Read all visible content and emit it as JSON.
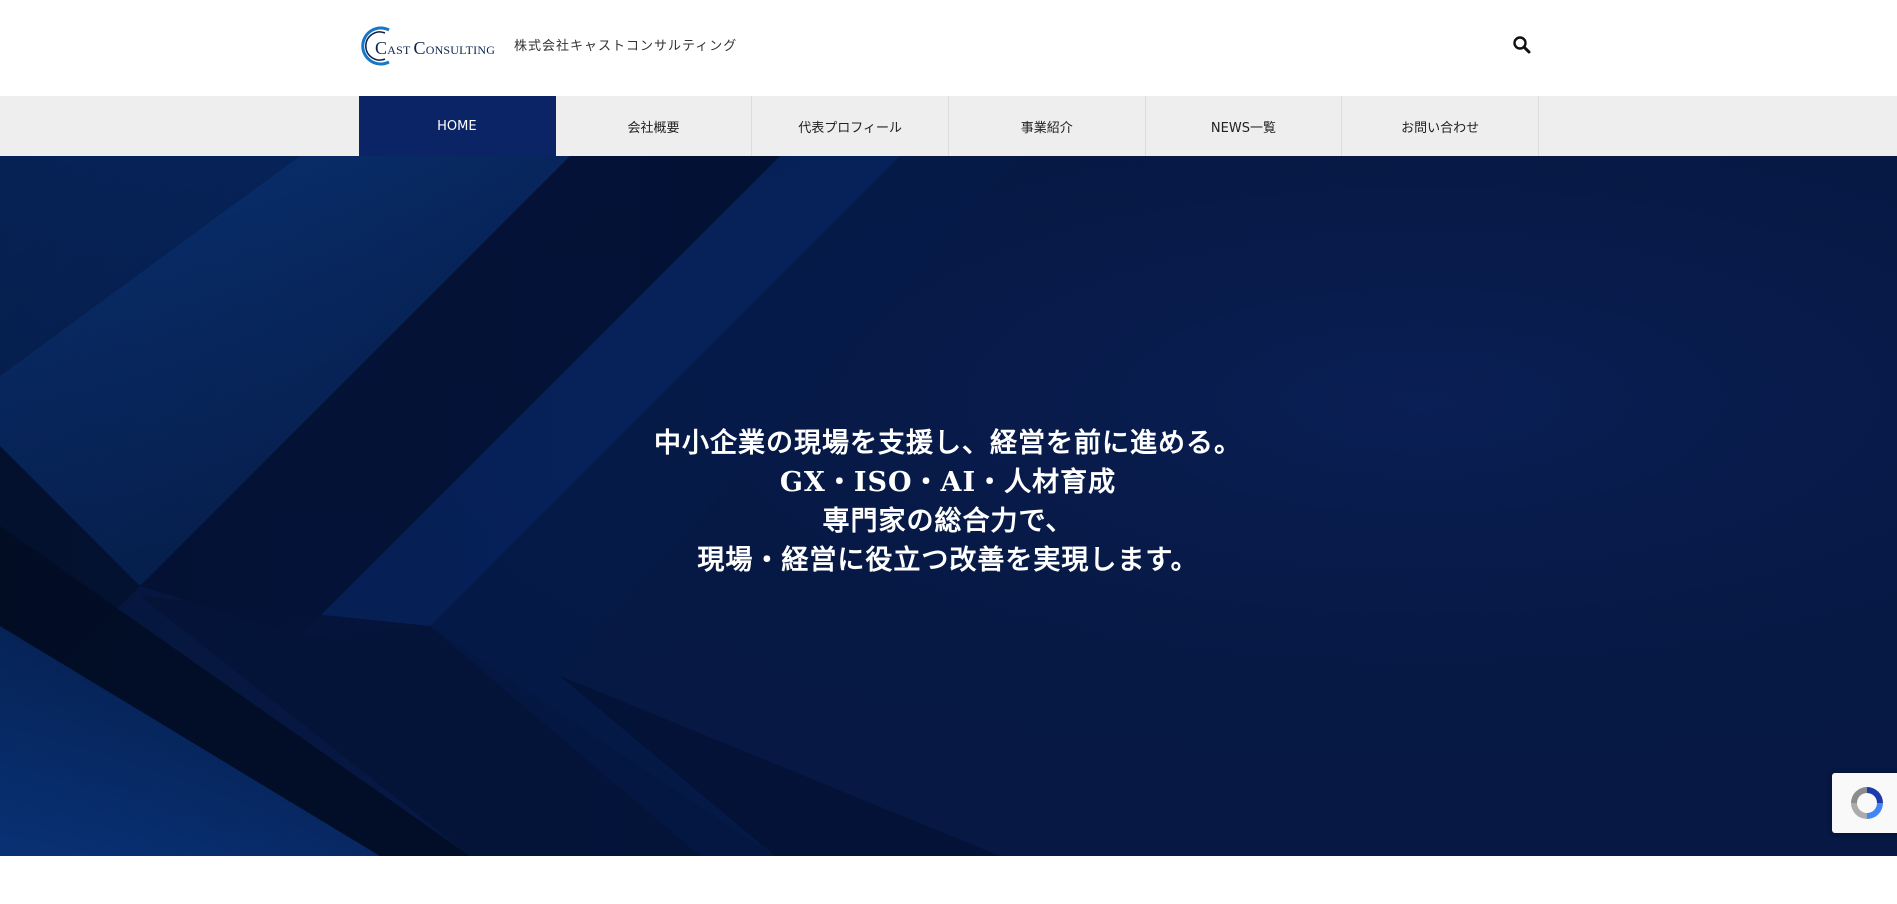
{
  "header": {
    "logo": {
      "text_first": "C",
      "text_rest": "AST ",
      "text_second": "C",
      "text_second_rest": "ONSULTING",
      "alt": "Cast Consulting"
    },
    "company_name": "株式会社キャストコンサルティング",
    "search_icon": "search-icon"
  },
  "nav": {
    "items": [
      {
        "label": "HOME",
        "active": true
      },
      {
        "label": "会社概要",
        "active": false
      },
      {
        "label": "代表プロフィール",
        "active": false
      },
      {
        "label": "事業紹介",
        "active": false
      },
      {
        "label": "NEWS一覧",
        "active": false
      },
      {
        "label": "お問い合わせ",
        "active": false
      }
    ]
  },
  "hero": {
    "lines": [
      "中小企業の現場を支援し、経営を前に進める。",
      "GX・ISO・AI・人材育成",
      "専門家の総合力で、",
      "現場・経営に役立つ改善を実現します。"
    ]
  },
  "recaptcha": {
    "icon": "recaptcha-icon"
  },
  "colors": {
    "nav_active": "#0a2466",
    "hero_bg": "#061843",
    "accent_blue": "#0b4a9a"
  }
}
